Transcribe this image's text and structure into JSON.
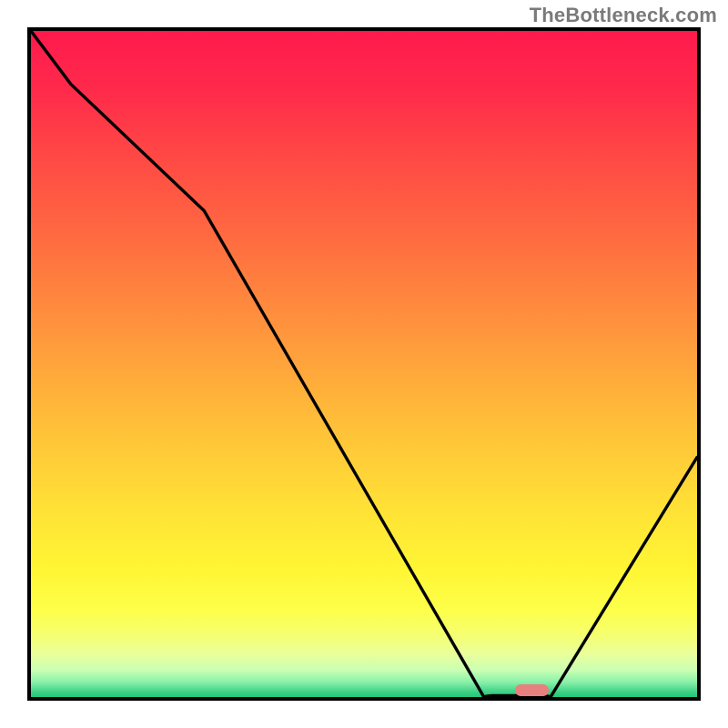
{
  "watermark": "TheBottleneck.com",
  "chart_data": {
    "type": "line",
    "title": "",
    "xlabel": "",
    "ylabel": "",
    "x": [
      0.0,
      0.06,
      0.26,
      0.68,
      0.73,
      0.78,
      1.0
    ],
    "values": [
      1.0,
      0.92,
      0.73,
      0.0,
      0.0,
      0.0,
      0.36
    ],
    "xlim": [
      0,
      1
    ],
    "ylim": [
      0,
      1
    ],
    "highlight_x_range": [
      0.727,
      0.778
    ],
    "gradient_stops": [
      {
        "offset": 0.0,
        "color": "#ff1a4d"
      },
      {
        "offset": 0.09,
        "color": "#ff2a4b"
      },
      {
        "offset": 0.18,
        "color": "#ff4645"
      },
      {
        "offset": 0.27,
        "color": "#ff5f42"
      },
      {
        "offset": 0.36,
        "color": "#ff7a3f"
      },
      {
        "offset": 0.45,
        "color": "#ff953d"
      },
      {
        "offset": 0.54,
        "color": "#ffb03a"
      },
      {
        "offset": 0.63,
        "color": "#ffca38"
      },
      {
        "offset": 0.72,
        "color": "#ffe236"
      },
      {
        "offset": 0.81,
        "color": "#fff634"
      },
      {
        "offset": 0.87,
        "color": "#fdff4a"
      },
      {
        "offset": 0.905,
        "color": "#f6ff6e"
      },
      {
        "offset": 0.935,
        "color": "#eaff9a"
      },
      {
        "offset": 0.96,
        "color": "#c9ffb4"
      },
      {
        "offset": 0.978,
        "color": "#87f0a8"
      },
      {
        "offset": 0.992,
        "color": "#3fd186"
      },
      {
        "offset": 1.0,
        "color": "#1fc876"
      }
    ]
  }
}
